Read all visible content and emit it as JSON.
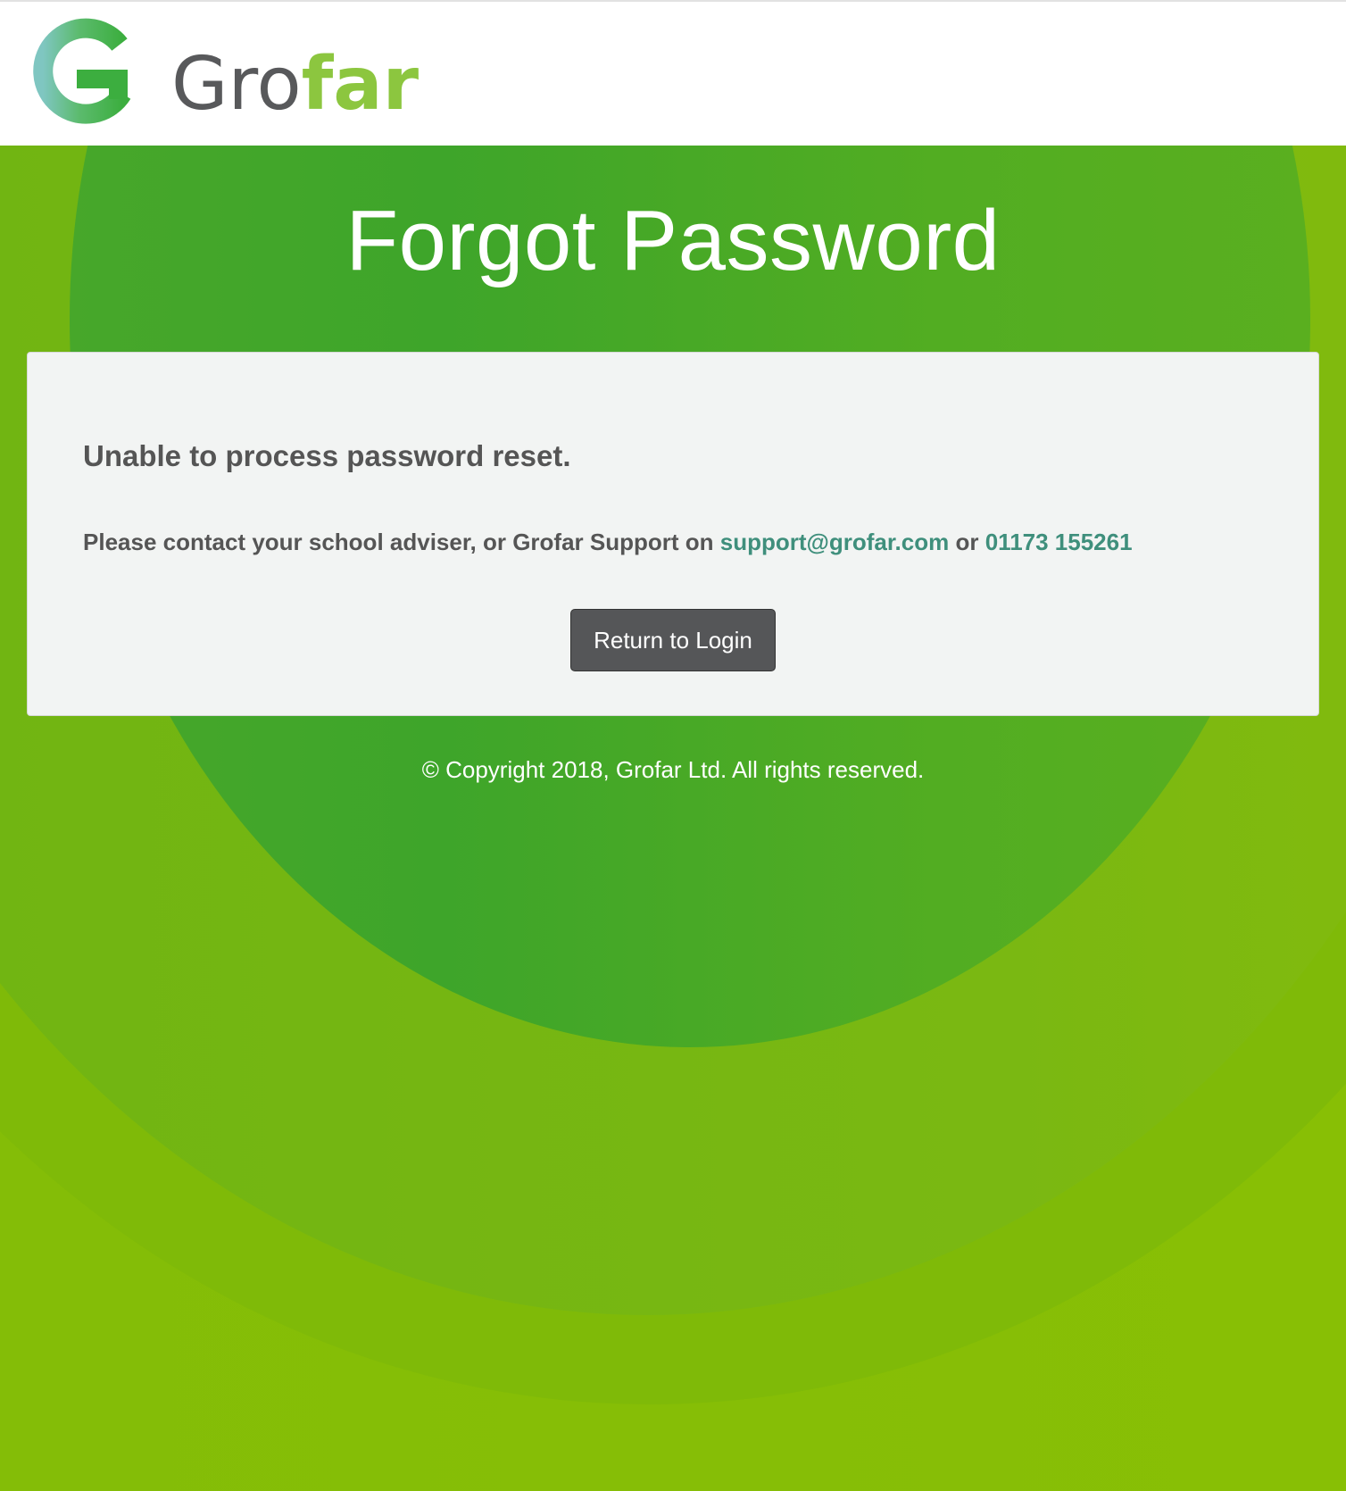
{
  "header": {
    "logo": {
      "icon": "grofar-g-logo-icon",
      "wordmark_part1": "Gro",
      "wordmark_part2": "far",
      "colors": {
        "dark_text": "#58595b",
        "light_green": "#8cc63f",
        "ring_teal": "#7fc6c1",
        "ring_green": "#3cae3f"
      }
    }
  },
  "page": {
    "title": "Forgot Password"
  },
  "panel": {
    "heading": "Unable to process password reset.",
    "message_prefix": "Please contact your school adviser, or Grofar Support on",
    "email": "support@grofar.com",
    "connector": "or",
    "phone": "01173 155261",
    "button_label": "Return to Login"
  },
  "footer": {
    "copyright": "© Copyright 2018, Grofar Ltd. All rights reserved."
  },
  "colors": {
    "background_lime": "#88bf05",
    "circle_green": "#47a72a",
    "panel_bg": "#f2f4f3",
    "text_grey": "#555555",
    "link_teal": "#3f8f7c",
    "button_bg": "#555658"
  }
}
